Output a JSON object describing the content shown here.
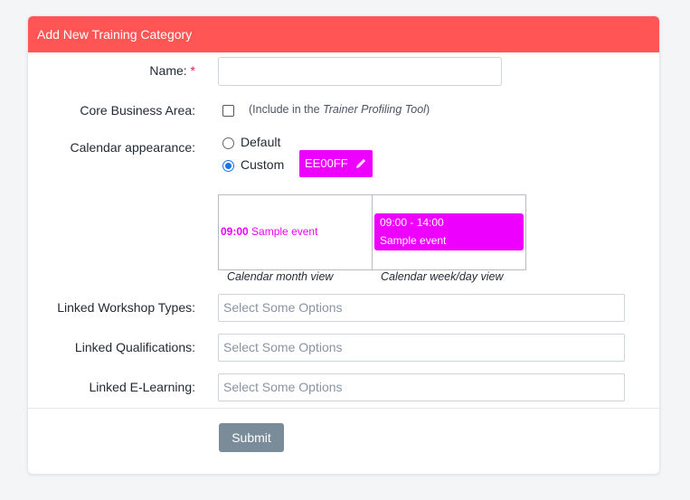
{
  "header": {
    "title": "Add New Training Category"
  },
  "form": {
    "name": {
      "label": "Name:",
      "required_mark": "*",
      "value": ""
    },
    "core_business_area": {
      "label": "Core Business Area:",
      "checked": false,
      "hint_prefix": "(Include in the ",
      "hint_tool": "Trainer Profiling Tool",
      "hint_suffix": ")"
    },
    "calendar_appearance": {
      "label": "Calendar appearance:",
      "options": [
        {
          "label": "Default",
          "selected": false
        },
        {
          "label": "Custom",
          "selected": true
        }
      ],
      "color_value": "EE00FF",
      "color_hex": "#ee00ff"
    },
    "preview": {
      "month_time": "09:00",
      "month_title": "Sample event",
      "week_time": "09:00 - 14:00",
      "week_title": "Sample event",
      "month_caption": "Calendar month view",
      "week_caption": "Calendar week/day view"
    },
    "linked_workshop_types": {
      "label": "Linked Workshop Types:",
      "placeholder": "Select Some Options"
    },
    "linked_qualifications": {
      "label": "Linked Qualifications:",
      "placeholder": "Select Some Options"
    },
    "linked_elearning": {
      "label": "Linked E-Learning:",
      "placeholder": "Select Some Options"
    },
    "submit_label": "Submit"
  },
  "colors": {
    "header": "#ff5555",
    "accent": "#ee00ff",
    "submit": "#7a8c99",
    "radio": "#1a73e8"
  },
  "icons": {
    "edit": "pencil-icon"
  }
}
